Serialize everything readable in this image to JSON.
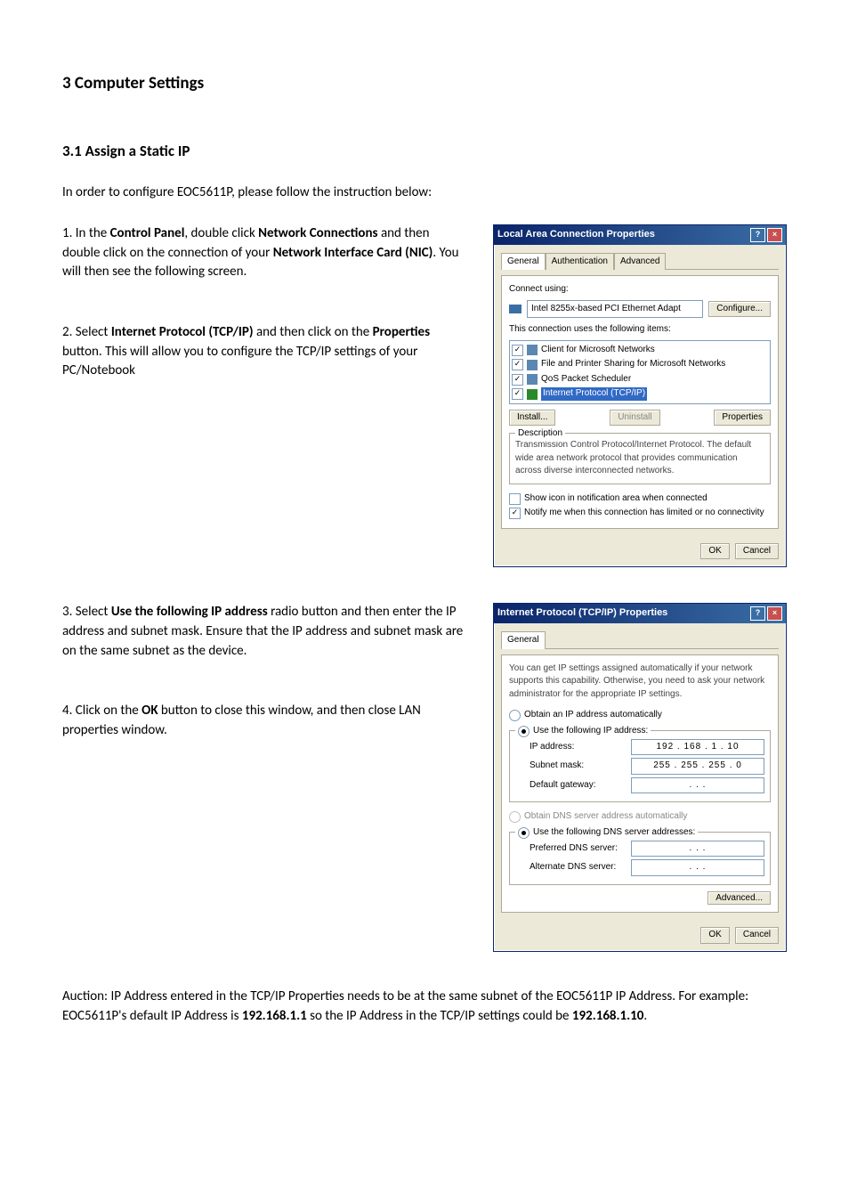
{
  "headings": {
    "section": "3 Computer Settings",
    "sub": "3.1 Assign a Static IP"
  },
  "intro": "In order to configure EOC5611P, please follow the instruction below:",
  "step1": {
    "prefix": "1. In the ",
    "b1": "Control Panel",
    "mid1": ", double click ",
    "b2": "Network Connections",
    "mid2": " and then double click on the connection of your ",
    "b3": "Network Interface Card (NIC)",
    "suffix": ". You will then see the following screen."
  },
  "step2": {
    "prefix": "2. Select ",
    "b1": "Internet Protocol (TCP/IP)",
    "mid1": " and then click on the ",
    "b2": "Properties",
    "suffix": " button. This will allow you to configure the TCP/IP settings of your PC/Notebook"
  },
  "step3": {
    "prefix": "3. Select ",
    "b1": "Use the following IP address",
    "suffix": " radio button and then enter the IP address and subnet mask. Ensure that the IP address and subnet mask are on the same subnet as the device."
  },
  "step4": {
    "prefix": "4. Click on the ",
    "b1": "OK",
    "suffix": " button to close this window, and then close LAN properties window."
  },
  "footnote": {
    "t1": "Auction: IP Address entered in the TCP/IP Properties needs to be at the same subnet of the EOC5611P IP Address. For example: EOC5611P's default IP Address is ",
    "b1": "192.168.1.1",
    "t2": " so the IP Address in the TCP/IP settings could be ",
    "b2": "192.168.1.10",
    "t3": "."
  },
  "dlg1": {
    "title": "Local Area Connection Properties",
    "tabs": {
      "general": "General",
      "auth": "Authentication",
      "adv": "Advanced"
    },
    "connect_using_label": "Connect using:",
    "adapter": "Intel 8255x-based PCI Ethernet Adapt",
    "configure_btn": "Configure...",
    "items_label": "This connection uses the following items:",
    "items": [
      "Client for Microsoft Networks",
      "File and Printer Sharing for Microsoft Networks",
      "QoS Packet Scheduler",
      "Internet Protocol (TCP/IP)"
    ],
    "install_btn": "Install...",
    "uninstall_btn": "Uninstall",
    "properties_btn": "Properties",
    "desc_title": "Description",
    "desc_text": "Transmission Control Protocol/Internet Protocol. The default wide area network protocol that provides communication across diverse interconnected networks.",
    "show_icon": "Show icon in notification area when connected",
    "notify_me": "Notify me when this connection has limited or no connectivity",
    "ok_btn": "OK",
    "cancel_btn": "Cancel"
  },
  "dlg2": {
    "title": "Internet Protocol (TCP/IP) Properties",
    "tab_general": "General",
    "intro": "You can get IP settings assigned automatically if your network supports this capability. Otherwise, you need to ask your network administrator for the appropriate IP settings.",
    "radio_obtain_ip": "Obtain an IP address automatically",
    "radio_use_ip": "Use the following IP address:",
    "ip_label": "IP address:",
    "ip_value": "192 . 168 .  1  . 10",
    "subnet_label": "Subnet mask:",
    "subnet_value": "255 . 255 . 255 .  0",
    "gateway_label": "Default gateway:",
    "gateway_value": " .   .   . ",
    "radio_obtain_dns": "Obtain DNS server address automatically",
    "radio_use_dns": "Use the following DNS server addresses:",
    "pref_dns_label": "Preferred DNS server:",
    "pref_dns_value": " .   .   . ",
    "alt_dns_label": "Alternate DNS server:",
    "alt_dns_value": " .   .   . ",
    "advanced_btn": "Advanced...",
    "ok_btn": "OK",
    "cancel_btn": "Cancel"
  }
}
